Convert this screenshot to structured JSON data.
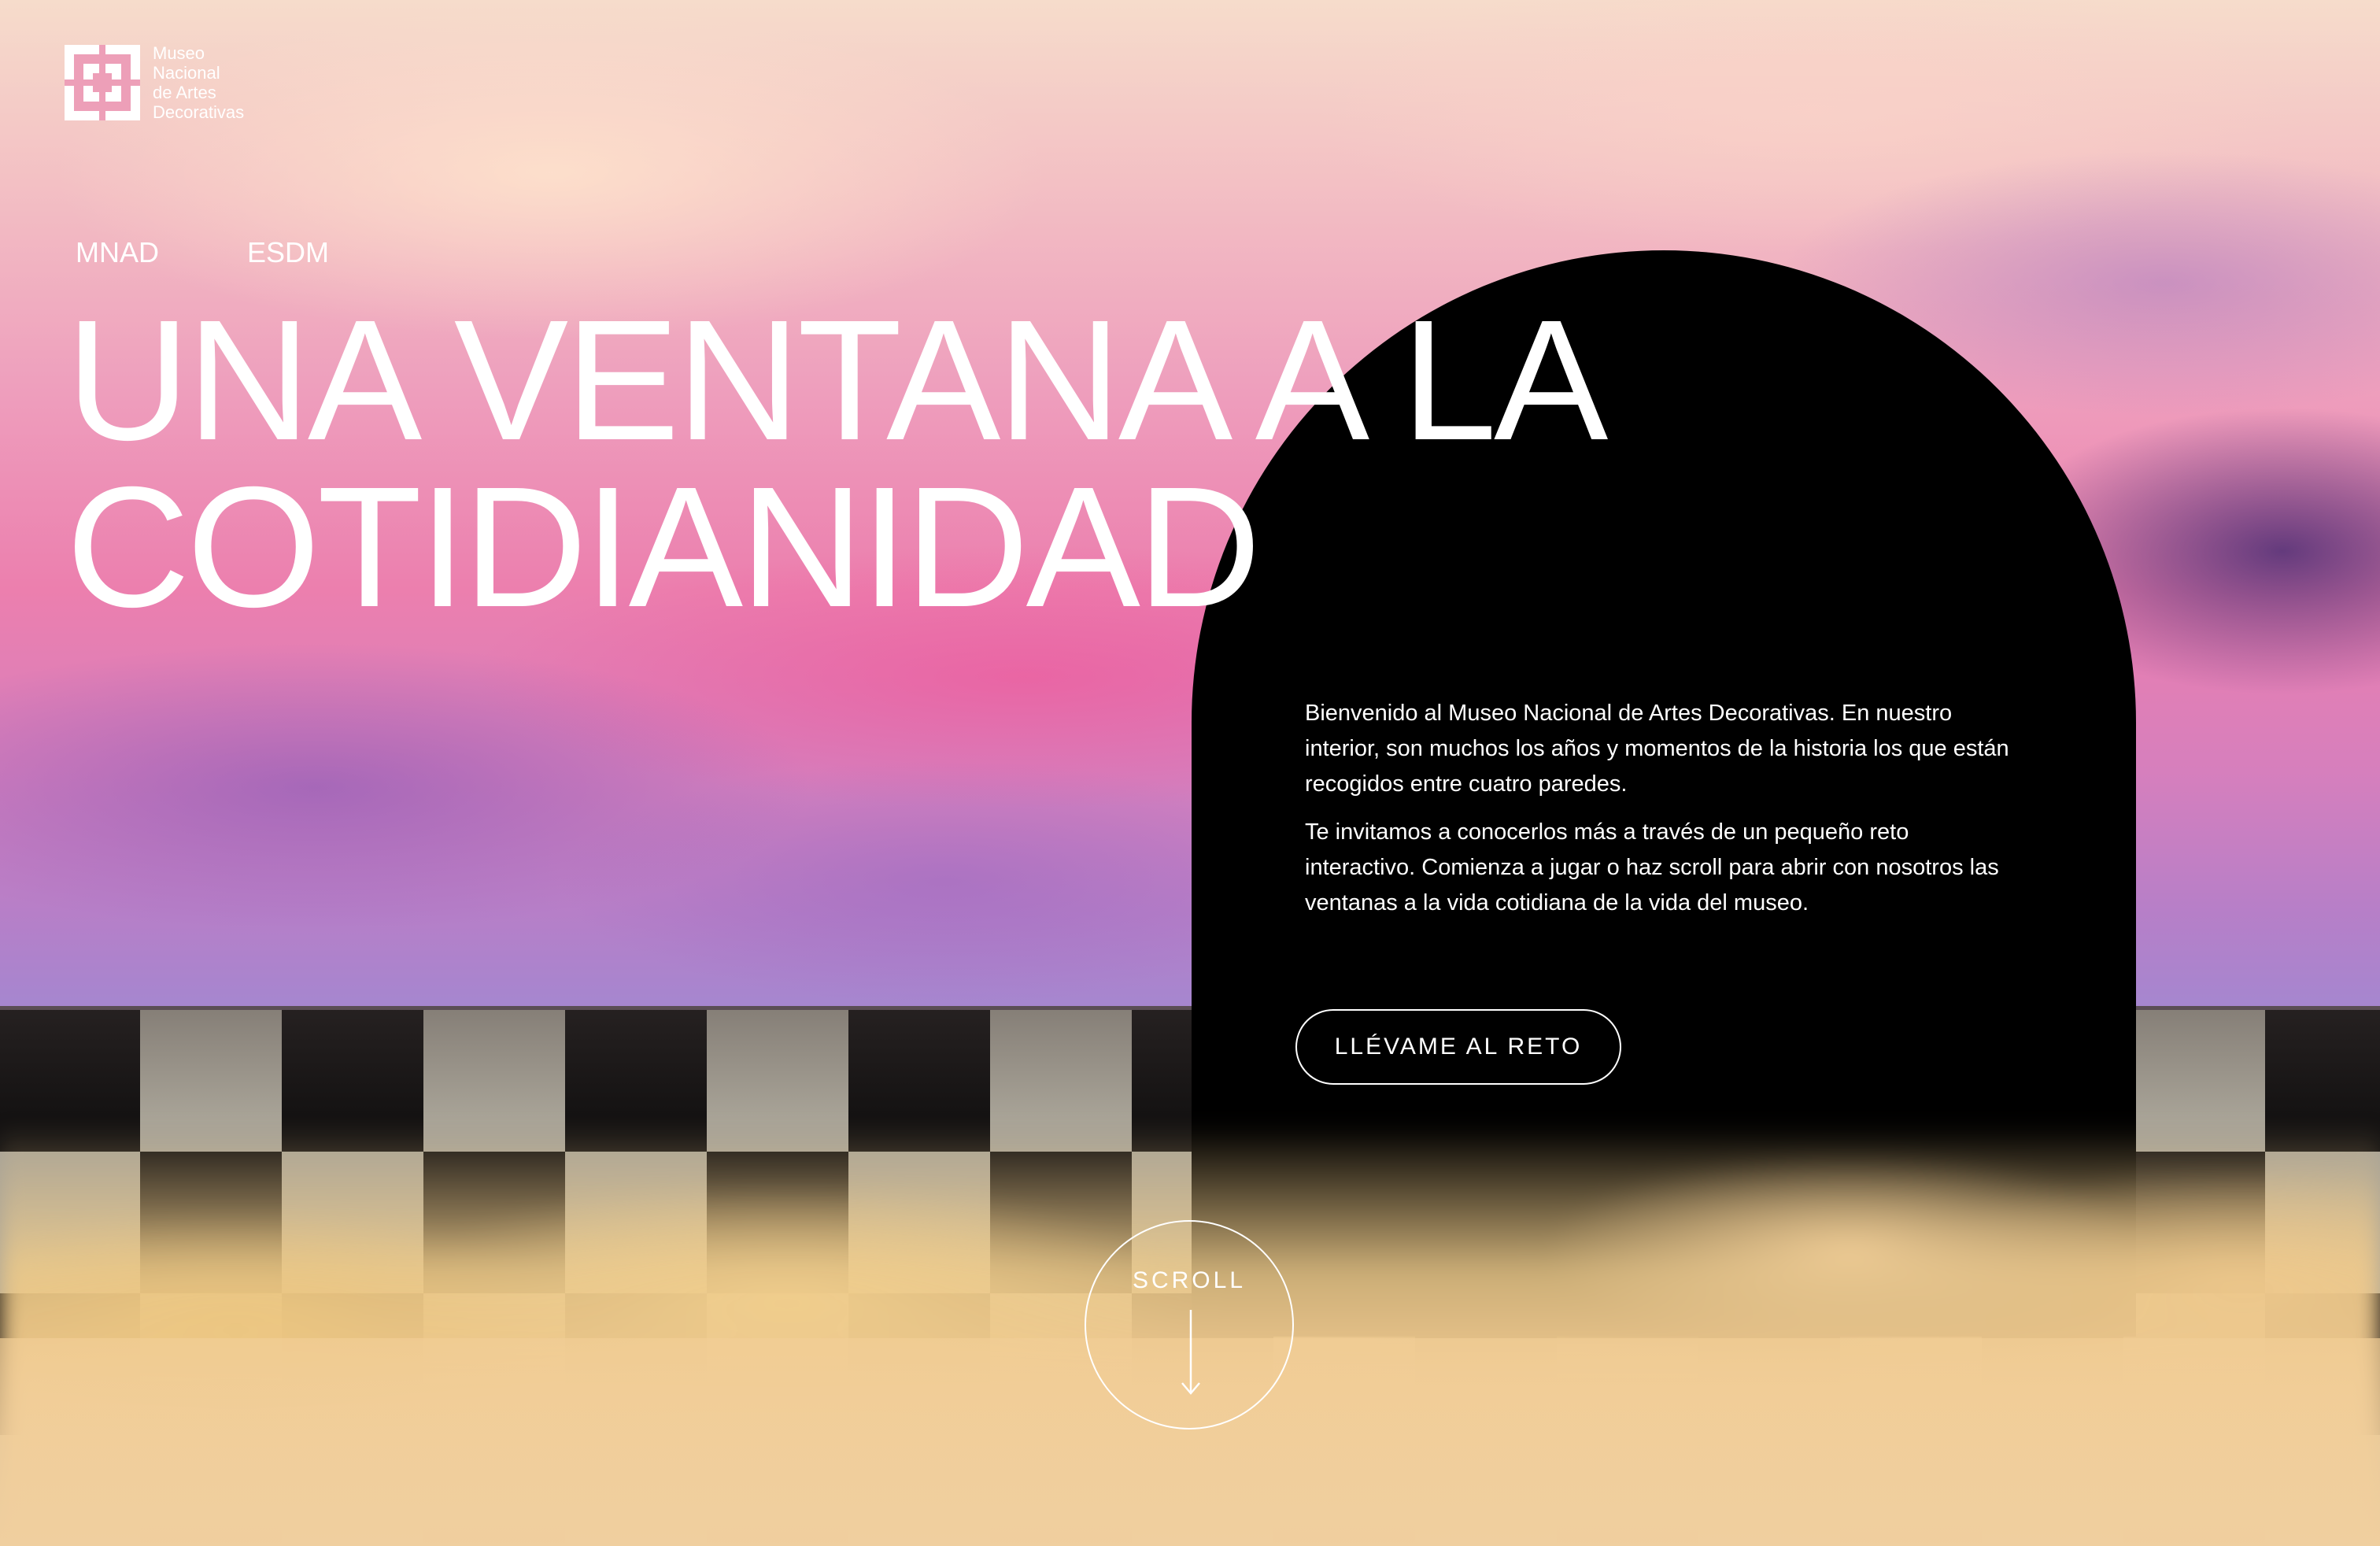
{
  "brand": {
    "logo_icon": "museum-grid-logo-icon",
    "lines": [
      "Museo",
      "Nacional",
      "de Artes",
      "Decorativas"
    ]
  },
  "nav": {
    "mnad": "MNAD",
    "esdm": "ESDM"
  },
  "hero": {
    "title_line1": "UNA VENTANA A LA",
    "title_line2": "COTIDIANIDAD"
  },
  "intro": {
    "p1": "Bienvenido al Museo Nacional de Artes Decorativas. En nuestro interior, son muchos los años y momentos de la historia  los que están recogidos entre cuatro paredes.",
    "p2": "Te invitamos a conocerlos más a través de un pequeño reto interactivo. Comienza a jugar o haz scroll para abrir con nosotros las ventanas a la vida cotidiana de la vida del museo."
  },
  "cta": {
    "label": "LLÉVAME AL RETO"
  },
  "scroll": {
    "label": "SCROLL",
    "icon": "arrow-down-icon"
  },
  "colors": {
    "arch": "#000000",
    "text": "#ffffff",
    "sky_pink": "#ec7fae",
    "sand": "#efc890"
  }
}
